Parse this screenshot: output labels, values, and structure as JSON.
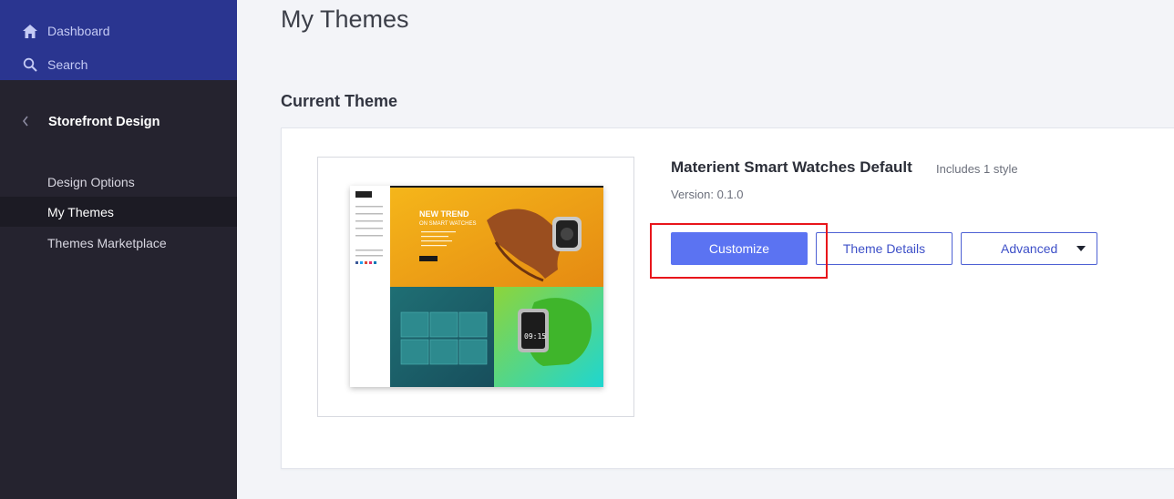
{
  "sidebar": {
    "top_links": [
      {
        "label": "Dashboard",
        "icon": "home-icon"
      },
      {
        "label": "Search",
        "icon": "search-icon"
      }
    ],
    "section": {
      "label": "Storefront Design",
      "icon": "chevron-left-icon"
    },
    "items": [
      {
        "label": "Design Options",
        "active": false
      },
      {
        "label": "My Themes",
        "active": true
      },
      {
        "label": "Themes Marketplace",
        "active": false
      }
    ]
  },
  "main": {
    "page_title": "My Themes",
    "current_theme_heading": "Current Theme",
    "theme": {
      "name": "Materient Smart Watches Default",
      "styles": "Includes 1 style",
      "version": "Version: 0.1.0",
      "preview": {
        "hero_title": "NEW TREND",
        "hero_subtitle": "ON SMART WATCHES",
        "watch_time": "09:15"
      }
    },
    "buttons": {
      "customize": "Customize",
      "theme_details": "Theme Details",
      "advanced": "Advanced"
    }
  },
  "colors": {
    "sidebar_bg": "#25232f",
    "sidebar_top_bg": "#2a3590",
    "primary": "#5b73f2",
    "highlight": "#e8151b"
  }
}
